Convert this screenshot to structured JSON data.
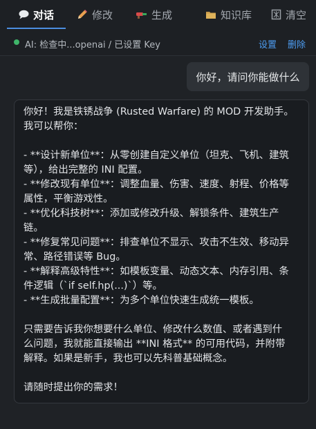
{
  "tabs": [
    {
      "label": "对话",
      "icon": "chat-bubble-icon",
      "active": true
    },
    {
      "label": "修改",
      "icon": "pencil-icon",
      "active": false
    },
    {
      "label": "生成",
      "icon": "paint-brush-icon",
      "active": false
    },
    {
      "label": "知识库",
      "icon": "folder-icon",
      "active": false
    },
    {
      "label": "清空",
      "icon": "trash-icon",
      "active": false
    }
  ],
  "colors": {
    "accent": "#4c8ee0",
    "status_ok": "#3fb56a",
    "link": "#4d9cf0"
  },
  "status": {
    "text": "AI: 检查中...openai / 已设置 Key",
    "settings_label": "设置",
    "delete_label": "删除"
  },
  "chat": {
    "user_message": "你好，请问你能做什么",
    "assistant_lines": [
      "你好！我是铁锈战争 (Rusted Warfare) 的 MOD 开发助手。",
      "我可以帮你：",
      "",
      "- **设计新单位**：从零创建自定义单位（坦克、飞机、建筑",
      "等），给出完整的 INI 配置。",
      "- **修改现有单位**：调整血量、伤害、速度、射程、价格等",
      "属性，平衡游戏性。",
      "- **优化科技树**：添加或修改升级、解锁条件、建筑生产",
      "链。",
      "- **修复常见问题**：排查单位不显示、攻击不生效、移动异",
      "常、路径错误等 Bug。",
      "- **解释高级特性**：如模板变量、动态文本、内存引用、条",
      "件逻辑（`if self.hp(...)`）等。",
      "- **生成批量配置**：为多个单位快速生成统一模板。",
      "",
      "只需要告诉我你想要什么单位、修改什么数值、或者遇到什",
      "么问题，我就能直接输出 **INI 格式** 的可用代码，并附带",
      "解释。如果是新手，我也可以先科普基础概念。",
      "",
      "请随时提出你的需求！"
    ]
  }
}
